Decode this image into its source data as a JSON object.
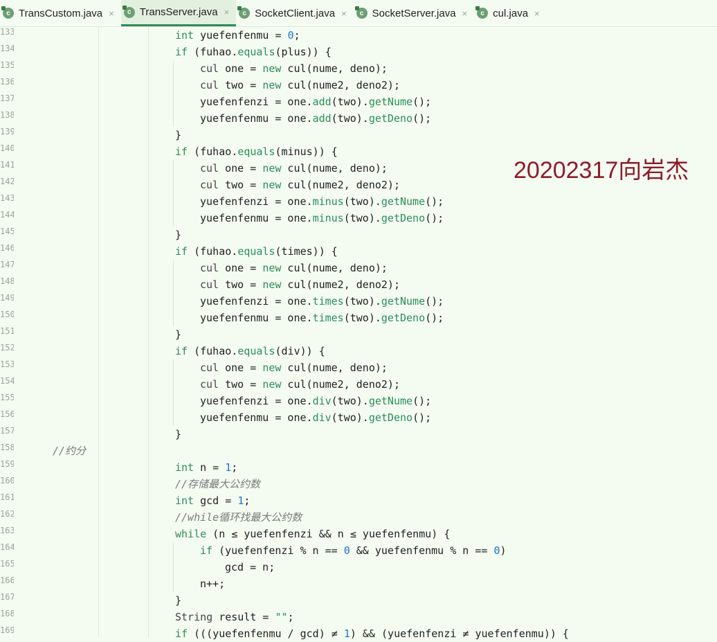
{
  "tabs": [
    {
      "label": "TransCustom.java",
      "active": false,
      "icon": "java-class-icon"
    },
    {
      "label": "TransServer.java",
      "active": true,
      "icon": "java-class-icon"
    },
    {
      "label": "SocketClient.java",
      "active": false,
      "icon": "java-class-icon"
    },
    {
      "label": "SocketServer.java",
      "active": false,
      "icon": "java-class-icon"
    },
    {
      "label": "cul.java",
      "active": false,
      "icon": "java-class-icon"
    }
  ],
  "tab_close_glyph": "×",
  "tab_icon_letter": "c",
  "line_numbers": [
    "133",
    "134",
    "135",
    "136",
    "137",
    "138",
    "139",
    "140",
    "141",
    "142",
    "143",
    "144",
    "145",
    "146",
    "147",
    "148",
    "149",
    "150",
    "151",
    "152",
    "153",
    "154",
    "155",
    "156",
    "157",
    "158",
    "159",
    "160",
    "161",
    "162",
    "163",
    "164",
    "165",
    "166",
    "167",
    "168",
    "169"
  ],
  "code": [
    "int yuefenfenmu = 0;",
    "if (fuhao.equals(plus)) {",
    "cul one = new cul(nume, deno);",
    "cul two = new cul(nume2, deno2);",
    "yuefenfenzi = one.add(two).getNume();",
    "yuefenfenmu = one.add(two).getDeno();",
    "}",
    "if (fuhao.equals(minus)) {",
    "cul one = new cul(nume, deno);",
    "cul two = new cul(nume2, deno2);",
    "yuefenfenzi = one.minus(two).getNume();",
    "yuefenfenmu = one.minus(two).getDeno();",
    "}",
    "if (fuhao.equals(times)) {",
    "cul one = new cul(nume, deno);",
    "cul two = new cul(nume2, deno2);",
    "yuefenfenzi = one.times(two).getNume();",
    "yuefenfenmu = one.times(two).getDeno();",
    "}",
    "if (fuhao.equals(div)) {",
    "cul one = new cul(nume, deno);",
    "cul two = new cul(nume2, deno2);",
    "yuefenfenzi = one.div(two).getNume();",
    "yuefenfenmu = one.div(two).getDeno();",
    "}",
    "//约分",
    "int n = 1;",
    "//存储最大公约数",
    "int gcd = 1;",
    "//while循环找最大公约数",
    "while (n ≤ yuefenfenzi && n ≤ yuefenfenmu) {",
    "if (yuefenfenzi % n == 0 && yuefenfenmu % n == 0)",
    "gcd = n;",
    "n++;",
    "}",
    "String result = \"\";",
    "if (((yuefenfenmu / gcd) ≠ 1) && (yuefenfenzi ≠ yuefenfenmu)) {"
  ],
  "watermark": "20202317向岩杰",
  "colors": {
    "background": "#f4fbf1",
    "keyword": "#2e8b57",
    "number": "#1c76c9",
    "comment": "#7a7a7a",
    "watermark": "#8b1c2a",
    "active_tab_underline": "#2e8b57"
  }
}
